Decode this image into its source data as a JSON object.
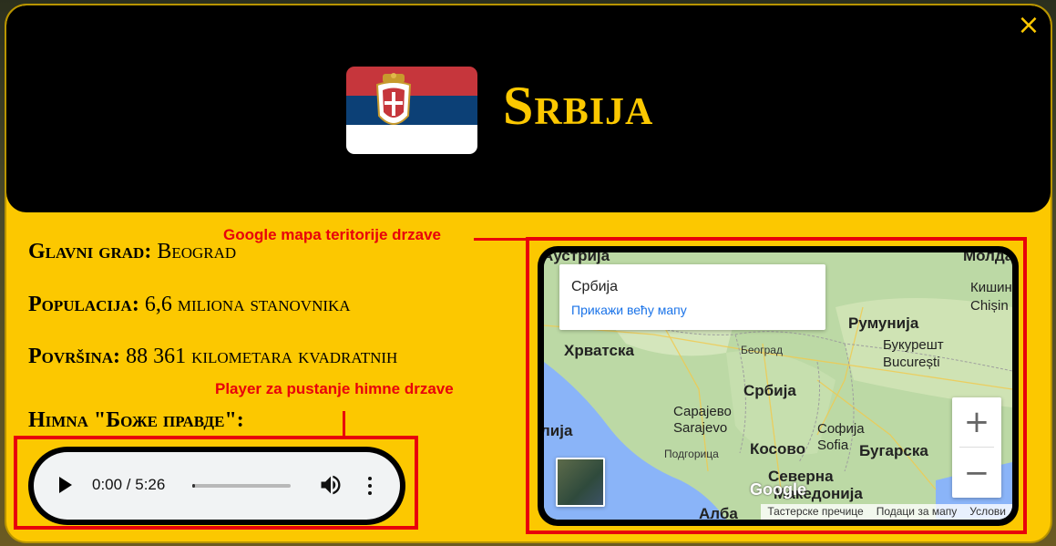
{
  "title": "Srbija",
  "close_icon": "×",
  "info": {
    "capital_label": "Glavni grad:",
    "capital_value": "Beograd",
    "population_label": "Populacija:",
    "population_value": "6,6 miliona stanovnika",
    "area_label": "Površina:",
    "area_value": "88 361 kilometara kvadratnih",
    "anthem_label": "Himna \"Боже правде\":"
  },
  "annotations": {
    "map_note": "Google mapa teritorije drzave",
    "player_note": "Player za pustanje himne drzave"
  },
  "player": {
    "time": "0:00 / 5:26",
    "progress": 0.0
  },
  "map": {
    "place_name": "Србија",
    "view_larger": "Прикажи већу мапу",
    "labels": {
      "austria": "Аустрија",
      "moldova": "Молдав",
      "kishinev": "Кишин",
      "chisin": "Chișin",
      "romania": "Румунија",
      "croatia": "Хрватска",
      "beograd": "Београд",
      "bucuresti_cyr": "Букурешт",
      "bucuresti_lat": "București",
      "srbija": "Србија",
      "sarajevo_cyr": "Сарајево",
      "sarajevo_lat": "Sarajevo",
      "sofija_cyr": "Софија",
      "sofija_lat": "Sofia",
      "lija": "лија",
      "podgorica": "Подгорица",
      "kosovo": "Косово",
      "bugarska": "Бугарска",
      "severna": "Северна",
      "makedonija": "Македонија",
      "albanija": "Алба"
    },
    "zoom_in": "+",
    "zoom_out": "−",
    "footer": [
      "Тастерске пречице",
      "Подаци за мапу",
      "Услови"
    ],
    "google": "Google"
  },
  "colors": {
    "accent": "#fcc800",
    "annotation": "#e8000b",
    "header_bg": "#000000"
  }
}
